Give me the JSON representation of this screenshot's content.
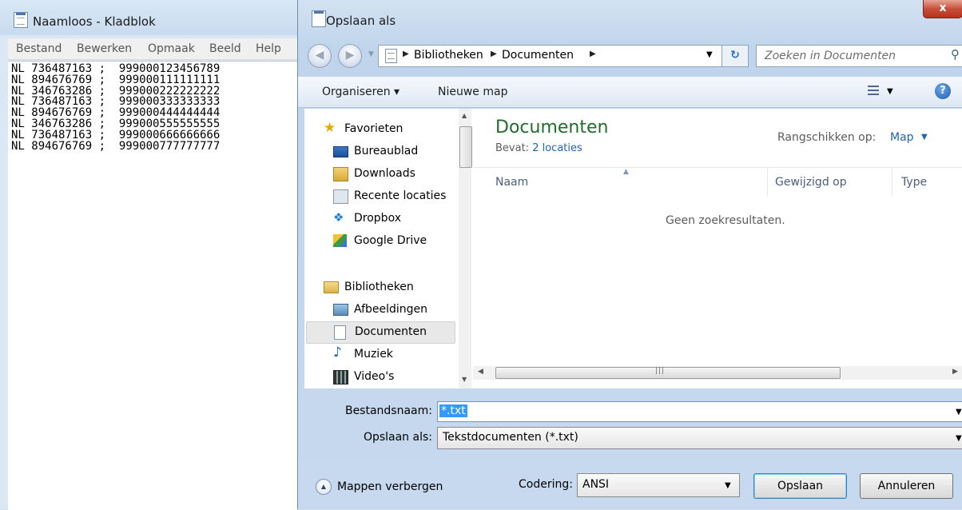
{
  "notepad": {
    "title": "Naamloos - Kladblok",
    "menu": [
      "Bestand",
      "Bewerken",
      "Opmaak",
      "Beeld",
      "Help"
    ],
    "content": "NL 736487163 ;  999000123456789\nNL 894676769 ;  999000111111111\nNL 346763286 ;  999000222222222\nNL 736487163 ;  999000333333333\nNL 894676769 ;  999000444444444\nNL 346763286 ;  999000555555555\nNL 736487163 ;  999000666666666\nNL 894676769 ;  999000777777777"
  },
  "dialog": {
    "title": "Opslaan als",
    "close_label": "x",
    "breadcrumb": [
      "Bibliotheken",
      "Documenten"
    ],
    "search_placeholder": "Zoeken in Documenten",
    "toolbar": {
      "organize": "Organiseren ▾",
      "new_folder": "Nieuwe map"
    },
    "nav_pane": [
      {
        "label": "Favorieten",
        "icon": "star-icon"
      },
      {
        "label": "Bureaublad",
        "icon": "desktop-icon"
      },
      {
        "label": "Downloads",
        "icon": "downloads-icon"
      },
      {
        "label": "Recente locaties",
        "icon": "recent-places-icon"
      },
      {
        "label": "Dropbox",
        "icon": "dropbox-icon"
      },
      {
        "label": "Google Drive",
        "icon": "google-drive-icon"
      },
      {
        "label": "Bibliotheken",
        "icon": "libraries-icon"
      },
      {
        "label": "Afbeeldingen",
        "icon": "pictures-icon"
      },
      {
        "label": "Documenten",
        "icon": "documents-icon",
        "selected": true
      },
      {
        "label": "Muziek",
        "icon": "music-icon"
      },
      {
        "label": "Video's",
        "icon": "videos-icon"
      }
    ],
    "library": {
      "title": "Documenten",
      "contains_label": "Bevat:",
      "contains_link": "2 locaties",
      "arrange_label": "Rangschikken op:",
      "arrange_value": "Map"
    },
    "columns": [
      "Naam",
      "Gewijzigd op",
      "Type"
    ],
    "empty_message": "Geen zoekresultaten.",
    "filename_label": "Bestandsnaam:",
    "filename_value": "*.txt",
    "save_as_label": "Opslaan als:",
    "save_as_value": "Tekstdocumenten (*.txt)",
    "hide_folders_label": "Mappen verbergen",
    "encoding_label": "Codering:",
    "encoding_value": "ANSI",
    "save_button": "Opslaan",
    "cancel_button": "Annuleren"
  },
  "colors": {
    "library_title": "#1f6e2a",
    "link": "#1f62b8",
    "selection": "#3399ff",
    "close_button": "#c7503a"
  }
}
